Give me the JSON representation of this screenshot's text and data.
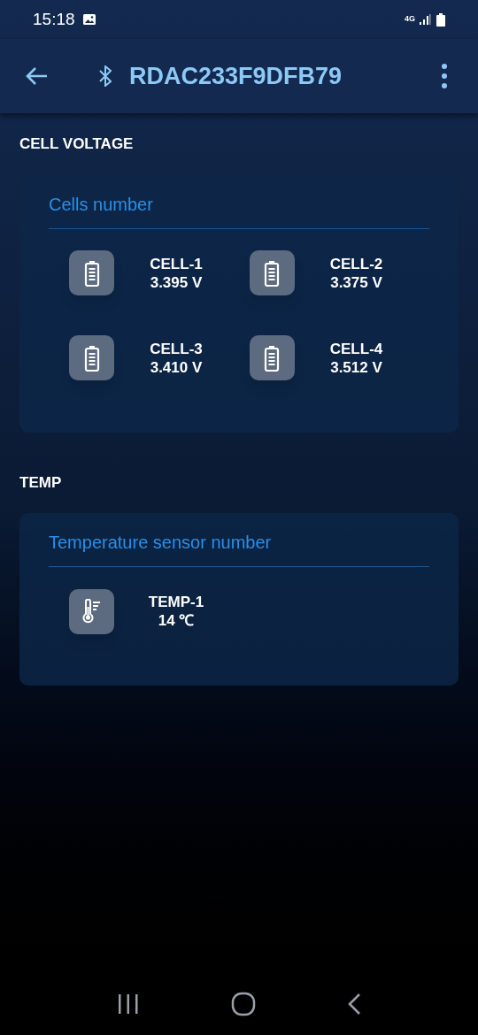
{
  "status_bar": {
    "time": "15:18",
    "network": "4G"
  },
  "app_bar": {
    "title": "RDAC233F9DFB79"
  },
  "sections": [
    {
      "heading": "CELL VOLTAGE",
      "card_title": "Cells number",
      "items": [
        {
          "kind": "battery",
          "name": "CELL-1",
          "value": "3.395 V"
        },
        {
          "kind": "battery",
          "name": "CELL-2",
          "value": "3.375 V"
        },
        {
          "kind": "battery",
          "name": "CELL-3",
          "value": "3.410 V"
        },
        {
          "kind": "battery",
          "name": "CELL-4",
          "value": "3.512 V"
        }
      ]
    },
    {
      "heading": "TEMP",
      "card_title": "Temperature sensor number",
      "items": [
        {
          "kind": "thermometer",
          "name": "TEMP-1",
          "value": "14 ℃"
        }
      ]
    }
  ]
}
